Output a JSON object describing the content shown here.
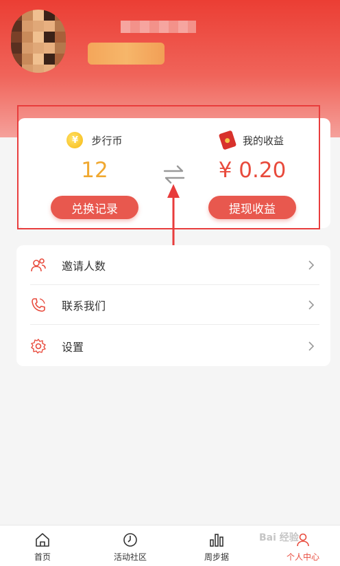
{
  "wallet": {
    "coin": {
      "label": "步行币",
      "value": "12",
      "button": "兑换记录",
      "icon": "coin-icon"
    },
    "earnings": {
      "label": "我的收益",
      "value": "¥ 0.20",
      "button": "提现收益",
      "icon": "red-envelope-icon"
    }
  },
  "menu": {
    "items": [
      {
        "label": "邀请人数",
        "icon": "invite-users-icon"
      },
      {
        "label": "联系我们",
        "icon": "phone-icon"
      },
      {
        "label": "设置",
        "icon": "gear-icon"
      }
    ]
  },
  "tabbar": {
    "tabs": [
      {
        "label": "首页",
        "icon": "home-icon"
      },
      {
        "label": "活动社区",
        "icon": "clock-icon"
      },
      {
        "label": "周步据",
        "icon": "bar-chart-icon"
      },
      {
        "label": "个人中心",
        "icon": "user-icon"
      }
    ],
    "active_index": 3
  },
  "watermark": "Bai 经验",
  "colors": {
    "header_top": "#eb3e34",
    "accent_red": "#e84a3c",
    "coin_yellow": "#f0a830",
    "button_red": "#e8584e",
    "annotation_red": "#e83c3c"
  }
}
